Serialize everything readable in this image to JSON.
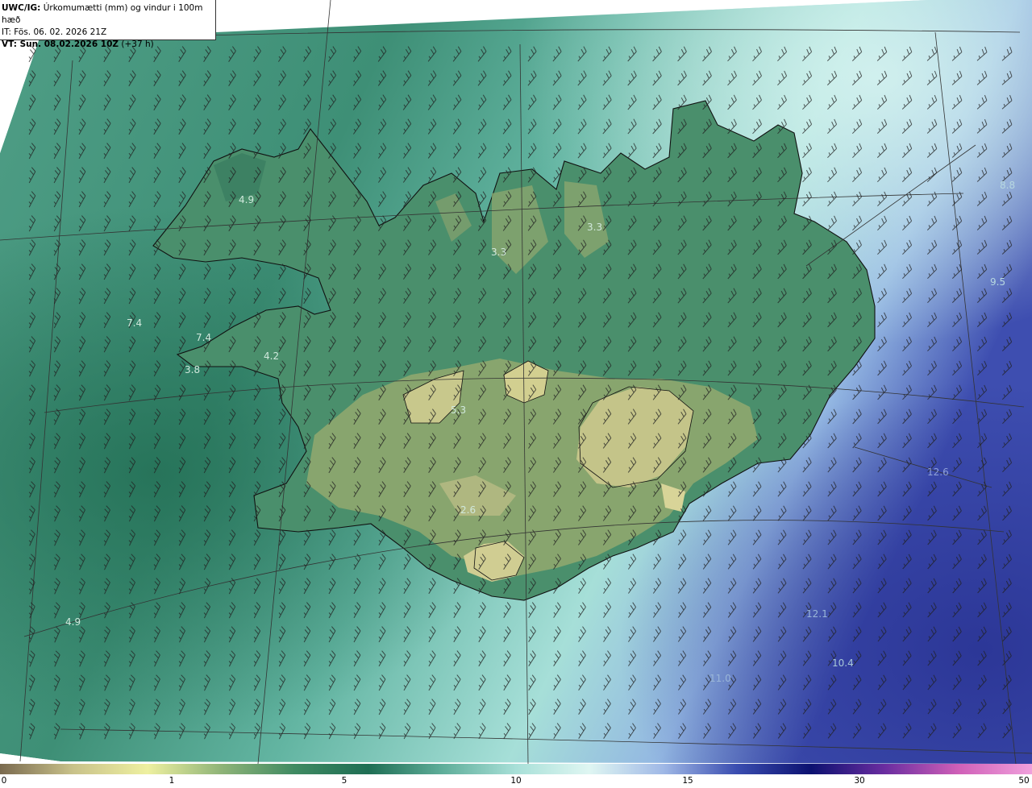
{
  "header": {
    "model": "UWC/IG:",
    "title": "Úrkomumætti (mm) og vindur i 100m hæð",
    "initial_time": "IT: Fös. 06. 02. 2026 21Z",
    "valid_prefix": "VT: Sun. 08.02.2026 10Z",
    "valid_offset": "(+37 h)"
  },
  "map": {
    "field": "precipitable water",
    "wind_barbs": "southwest",
    "labels": [
      "4.9",
      "3.3",
      "3.3",
      "7.4",
      "7.4",
      "4.2",
      "3.8",
      "5.3",
      "2.6",
      "4.9",
      "12.6",
      "12.1",
      "10.4",
      "11.0",
      "9.5",
      "8.8"
    ]
  },
  "colorbar": {
    "ticks": [
      "0",
      "1",
      "5",
      "10",
      "15",
      "30",
      "50"
    ],
    "colors": [
      "#7a6a4f",
      "#c9c28a",
      "#eef0a0",
      "#8fb478",
      "#3f8a62",
      "#1f6e54",
      "#5fae9a",
      "#a8e0d8",
      "#dff6f2",
      "#9fb8e6",
      "#3a4db0",
      "#0c1170",
      "#6a2da0",
      "#d060b8",
      "#f0a0dc"
    ]
  }
}
